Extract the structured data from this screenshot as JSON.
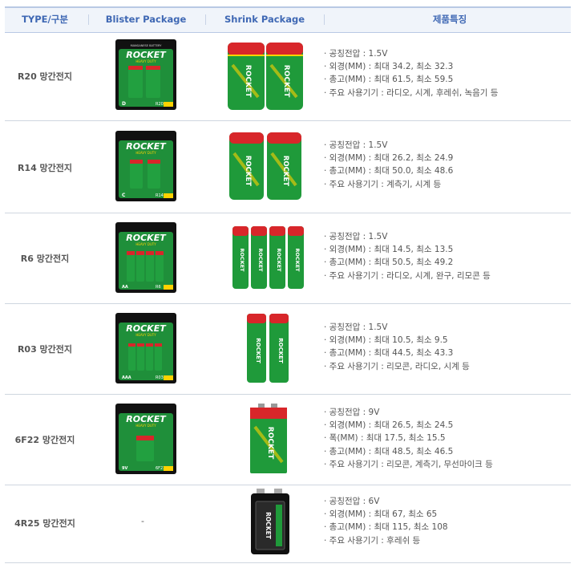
{
  "header": {
    "col_type": "TYPE/구분",
    "col_blister": "Blister Package",
    "col_shrink": "Shrink Package",
    "col_features": "제품특징"
  },
  "brand": {
    "name": "ROCKET",
    "tagline": "HEAVY DUTY"
  },
  "colors": {
    "header_text": "#3f68b4",
    "battery_green": "#1f9a3a",
    "battery_red": "#d8262a",
    "pack_black": "#111111"
  },
  "rows": [
    {
      "type": "R20 망간전지",
      "blister_size": "D",
      "blister_code": "R20",
      "specs": [
        "· 공칭전압 : 1.5V",
        "· 외경(MM) : 최대 34.2, 최소 32.3",
        "· 총고(MM) : 최대 61.5, 최소 59.5",
        "· 주요 사용기기 : 라디오, 시계, 후레쉬, 녹음기 등"
      ]
    },
    {
      "type": "R14 망간전지",
      "blister_size": "C",
      "blister_code": "R14",
      "specs": [
        "· 공칭전압 : 1.5V",
        "· 외경(MM) : 최대 26.2, 최소 24.9",
        "· 총고(MM) : 최대 50.0, 최소 48.6",
        "· 주요 사용기기 : 계측기, 시계 등"
      ]
    },
    {
      "type": "R6 망간전지",
      "blister_size": "AA",
      "blister_code": "R6",
      "specs": [
        "· 공칭전압 : 1.5V",
        "· 외경(MM) : 최대 14.5, 최소 13.5",
        "· 총고(MM) : 최대 50.5, 최소 49.2",
        "· 주요 사용기기 : 라디오, 시계, 완구, 리모콘 등"
      ]
    },
    {
      "type": "R03 망간전지",
      "blister_size": "AAA",
      "blister_code": "R03",
      "specs": [
        "· 공칭전압 : 1.5V",
        "· 외경(MM) : 최대 10.5, 최소 9.5",
        "· 총고(MM) : 최대 44.5, 최소 43.3",
        "· 주요 사용기기 : 리모콘, 라디오, 시계 등"
      ]
    },
    {
      "type": "6F22 망간전지",
      "blister_size": "9V",
      "blister_code": "6F22",
      "specs": [
        "· 공칭전압 : 9V",
        "· 외경(MM) : 최대 26.5, 최소 24.5",
        "· 폭(MM) : 최대 17.5, 최소 15.5",
        "· 총고(MM) : 최대 48.5, 최소 46.5",
        "· 주요 사용기기 : 리모콘, 계측기, 무선마이크 등"
      ]
    },
    {
      "type": "4R25 망간전지",
      "blister_none": "-",
      "specs": [
        "· 공칭전압 : 6V",
        "· 외경(MM) : 최대 67, 최소 65",
        "· 총고(MM) : 최대 115, 최소 108",
        "· 주요 사용기기 : 후레쉬 등"
      ]
    }
  ]
}
